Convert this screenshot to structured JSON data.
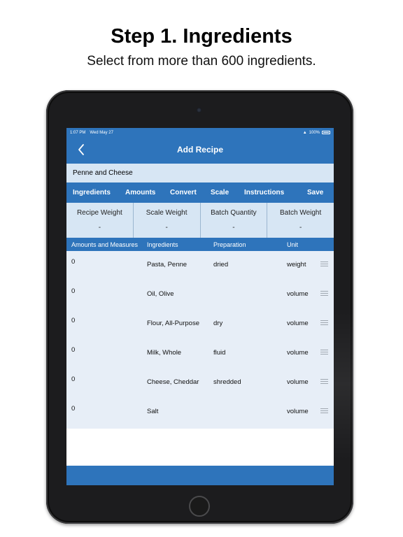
{
  "promo": {
    "headline": "Step 1. Ingredients",
    "subline": "Select from more than 600 ingredients."
  },
  "status_bar": {
    "time": "1:07 PM",
    "date": "Wed May 27",
    "battery": "100%"
  },
  "nav": {
    "title": "Add Recipe",
    "back_icon": "chevron-left-icon"
  },
  "recipe": {
    "name": "Penne and Cheese"
  },
  "tabs": [
    {
      "label": "Ingredients"
    },
    {
      "label": "Amounts"
    },
    {
      "label": "Convert"
    },
    {
      "label": "Scale"
    },
    {
      "label": "Instructions"
    },
    {
      "label": "Save"
    }
  ],
  "summary": [
    {
      "label": "Recipe Weight",
      "value": "-"
    },
    {
      "label": "Scale Weight",
      "value": "-"
    },
    {
      "label": "Batch Quantity",
      "value": "-"
    },
    {
      "label": "Batch Weight",
      "value": "-"
    }
  ],
  "columns": {
    "amounts": "Amounts and Measures",
    "ingredients": "Ingredients",
    "preparation": "Preparation",
    "unit": "Unit"
  },
  "rows": [
    {
      "amount": "0",
      "ingredient": "Pasta, Penne",
      "preparation": "dried",
      "unit": "weight"
    },
    {
      "amount": "0",
      "ingredient": "Oil, Olive",
      "preparation": "",
      "unit": "volume"
    },
    {
      "amount": "0",
      "ingredient": "Flour,  All-Purpose",
      "preparation": "dry",
      "unit": "volume"
    },
    {
      "amount": "0",
      "ingredient": "Milk, Whole",
      "preparation": "fluid",
      "unit": "volume"
    },
    {
      "amount": "0",
      "ingredient": "Cheese, Cheddar",
      "preparation": "shredded",
      "unit": "volume"
    },
    {
      "amount": "0",
      "ingredient": "Salt",
      "preparation": "",
      "unit": "volume"
    }
  ],
  "colors": {
    "brand_blue": "#2e74bb",
    "light_blue": "#d7e6f4",
    "row_background": "#e7eef7"
  }
}
